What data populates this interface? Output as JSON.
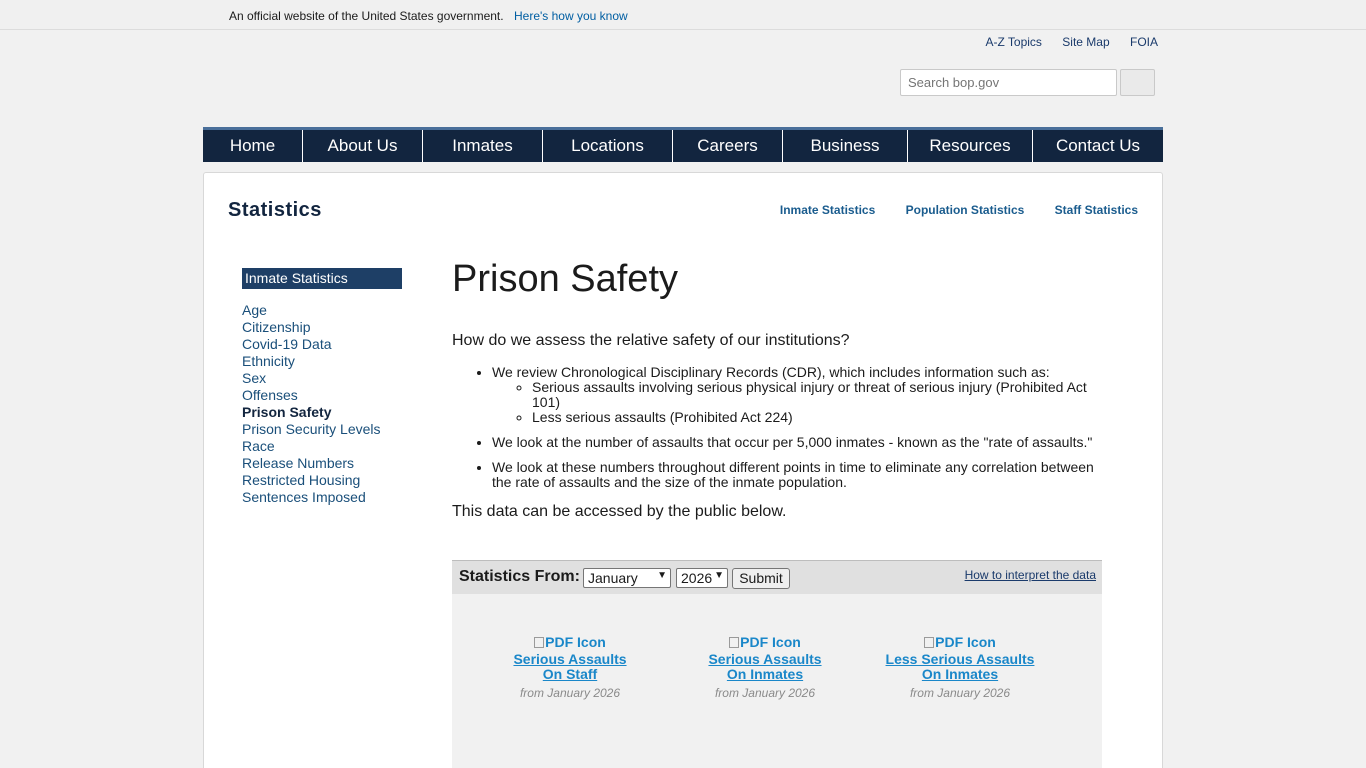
{
  "banner": {
    "text": "An official website of the United States government.",
    "link": "Here's how you know"
  },
  "utility_links": [
    "A-Z Topics",
    "Site Map",
    "FOIA"
  ],
  "search": {
    "placeholder": "Search bop.gov"
  },
  "nav": [
    "Home",
    "About Us",
    "Inmates",
    "Locations",
    "Careers",
    "Business",
    "Resources",
    "Contact Us"
  ],
  "section": {
    "title": "Statistics",
    "links": [
      "Inmate Statistics",
      "Population Statistics",
      "Staff Statistics"
    ]
  },
  "sidebar": {
    "heading": "Inmate Statistics",
    "items": [
      {
        "label": "Age"
      },
      {
        "label": "Citizenship"
      },
      {
        "label": "Covid-19 Data"
      },
      {
        "label": "Ethnicity"
      },
      {
        "label": "Sex"
      },
      {
        "label": "Offenses"
      },
      {
        "label": "Prison Safety",
        "active": true
      },
      {
        "label": "Prison Security Levels"
      },
      {
        "label": "Race"
      },
      {
        "label": "Release Numbers"
      },
      {
        "label": "Restricted Housing"
      },
      {
        "label": "Sentences Imposed"
      }
    ]
  },
  "main": {
    "title": "Prison Safety",
    "intro": "How do we assess the relative safety of our institutions?",
    "bullets": {
      "b1": "We review Chronological Disciplinary Records (CDR), which includes information such as:",
      "b1_sub1": "Serious assaults involving serious physical injury or threat of serious injury (Prohibited Act 101)",
      "b1_sub2": "Less serious assaults (Prohibited Act 224)",
      "b2": "We look at the number of assaults that occur per 5,000 inmates - known as the \"rate of assaults.\"",
      "b3": "We look at these numbers throughout different points in time to eliminate any correlation between the rate of assaults and the size of the inmate population."
    },
    "outro": "This data can be accessed by the public below."
  },
  "stats": {
    "from_label": "Statistics From:",
    "month": "January",
    "year": "2026",
    "submit": "Submit",
    "interpret_link": "How to interpret the data",
    "icon_alt": "PDF Icon",
    "reports": [
      {
        "name": "Serious Assaults\nOn Staff",
        "date": "from January 2026"
      },
      {
        "name": "Serious Assaults\nOn Inmates",
        "date": "from January 2026"
      },
      {
        "name": "Less Serious Assaults\nOn Inmates",
        "date": "from January 2026"
      }
    ]
  },
  "colors": {
    "nav_bg": "#12253f",
    "link": "#1a87c9",
    "sidebar_head": "#1e3f66"
  }
}
